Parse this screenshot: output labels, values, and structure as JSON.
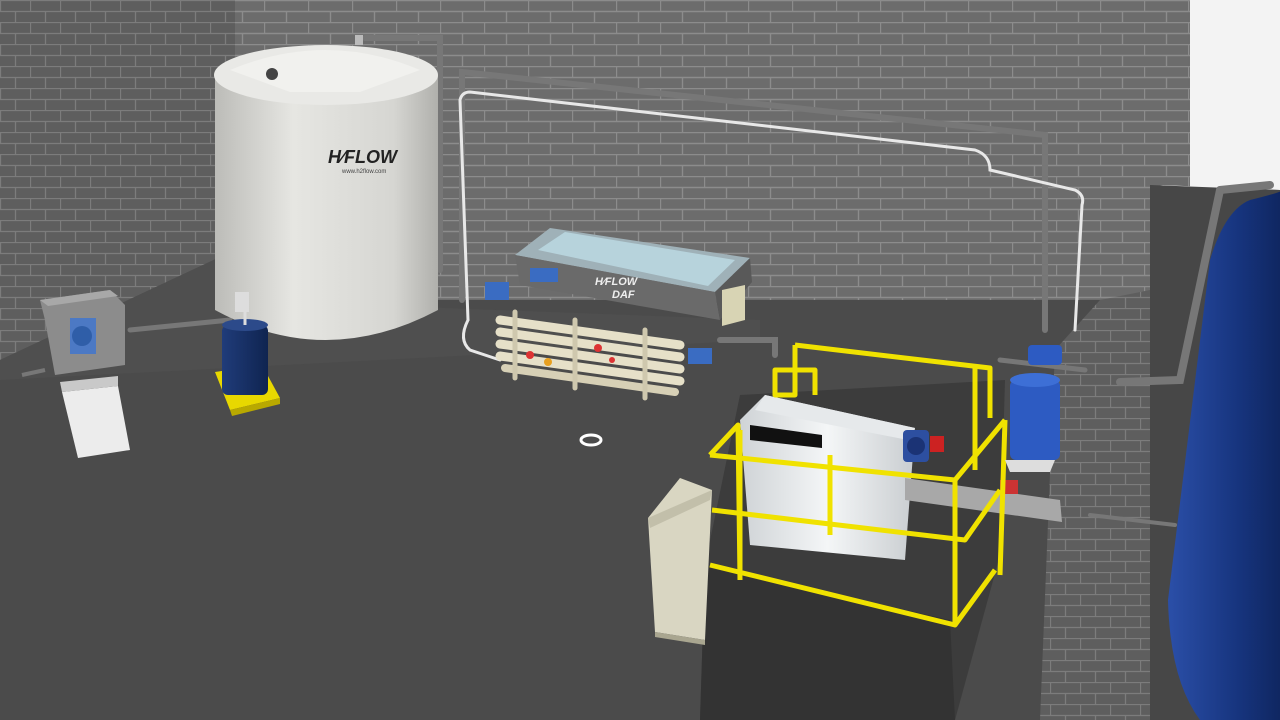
{
  "scene": {
    "tank_logo": "H⁄FLOW",
    "tank_url": "www.h2flow.com",
    "daf_logo": "H⁄FLOW",
    "daf_model": "DAF"
  },
  "colors": {
    "floor": "#4b4b4b",
    "brick_wall": "#6e6e6e",
    "mortar": "#8a8a8a",
    "tank_white": "#d9d9d6",
    "blue_tank": "#1d3c8a",
    "safety_yellow": "#f2e600",
    "pipe_gray": "#7a7a7a",
    "sky": "#f2f2f2"
  },
  "icons": {
    "navigation_marker": "waypoint-ring-icon"
  }
}
